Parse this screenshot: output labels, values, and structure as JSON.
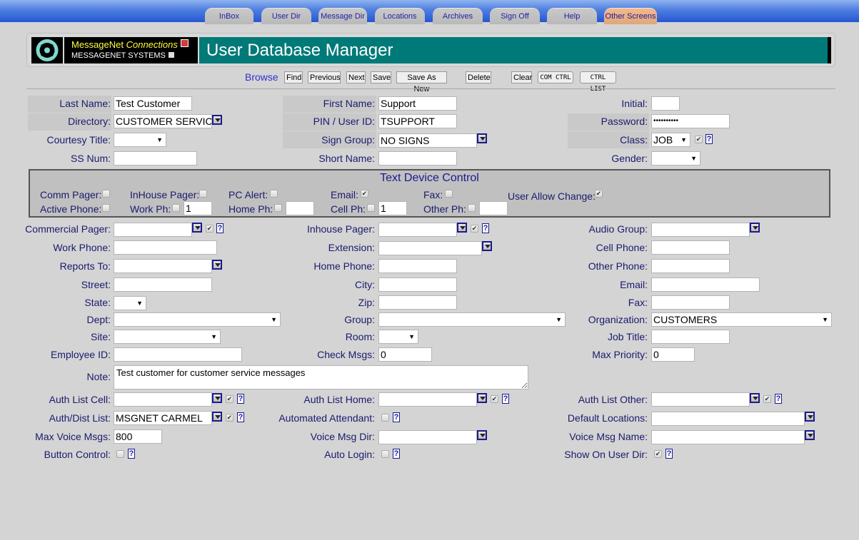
{
  "tabs": [
    {
      "label": "InBox",
      "active": false
    },
    {
      "label": "User Dir",
      "active": false
    },
    {
      "label": "Message Dir",
      "active": false
    },
    {
      "label": "Locations",
      "active": false
    },
    {
      "label": "Archives",
      "active": false
    },
    {
      "label": "Sign Off",
      "active": false
    },
    {
      "label": "Help",
      "active": false
    },
    {
      "label": "Other Screens",
      "active": true
    }
  ],
  "header": {
    "brand_line1_a": "MessageNet ",
    "brand_line1_b": "Connections",
    "brand_line2": "MESSAGENET SYSTEMS",
    "title": "User Database Manager",
    "accent_color": "#007a78"
  },
  "toolbar": {
    "mode": "Browse",
    "buttons": [
      "Find",
      "Previous",
      "Next",
      "Save",
      "Save As New",
      "Delete",
      "Clear",
      "COM CTRL",
      "CTRL LIST"
    ]
  },
  "fields": {
    "last_name": {
      "label": "Last Name:",
      "value": "Test Customer"
    },
    "first_name": {
      "label": "First Name:",
      "value": "Support"
    },
    "initial": {
      "label": "Initial:",
      "value": ""
    },
    "directory": {
      "label": "Directory:",
      "value": "CUSTOMER SERVICE"
    },
    "pin": {
      "label": "PIN / User ID:",
      "value": "TSUPPORT"
    },
    "password": {
      "label": "Password:",
      "value": "••••••••••"
    },
    "courtesy_title": {
      "label": "Courtesy Title:",
      "value": ""
    },
    "sign_group": {
      "label": "Sign Group:",
      "value": "NO SIGNS"
    },
    "class": {
      "label": "Class:",
      "value": "JOB",
      "checked": true
    },
    "ss_num": {
      "label": "SS Num:",
      "value": ""
    },
    "short_name": {
      "label": "Short Name:",
      "value": ""
    },
    "gender": {
      "label": "Gender:",
      "value": ""
    },
    "commercial_pager": {
      "label": "Commercial Pager:",
      "value": "",
      "checked": true
    },
    "inhouse_pager": {
      "label": "Inhouse Pager:",
      "value": "",
      "checked": true
    },
    "audio_group": {
      "label": "Audio Group:",
      "value": ""
    },
    "work_phone": {
      "label": "Work Phone:",
      "value": ""
    },
    "extension": {
      "label": "Extension:",
      "value": ""
    },
    "cell_phone": {
      "label": "Cell Phone:",
      "value": ""
    },
    "reports_to": {
      "label": "Reports To:",
      "value": ""
    },
    "home_phone": {
      "label": "Home Phone:",
      "value": ""
    },
    "other_phone": {
      "label": "Other Phone:",
      "value": ""
    },
    "street": {
      "label": "Street:",
      "value": ""
    },
    "city": {
      "label": "City:",
      "value": ""
    },
    "email": {
      "label": "Email:",
      "value": ""
    },
    "state": {
      "label": "State:",
      "value": ""
    },
    "zip": {
      "label": "Zip:",
      "value": ""
    },
    "fax": {
      "label": "Fax:",
      "value": ""
    },
    "dept": {
      "label": "Dept:",
      "value": ""
    },
    "group": {
      "label": "Group:",
      "value": ""
    },
    "organization": {
      "label": "Organization:",
      "value": "CUSTOMERS"
    },
    "site": {
      "label": "Site:",
      "value": ""
    },
    "room": {
      "label": "Room:",
      "value": ""
    },
    "job_title": {
      "label": "Job Title:",
      "value": ""
    },
    "employee_id": {
      "label": "Employee ID:",
      "value": ""
    },
    "check_msgs": {
      "label": "Check Msgs:",
      "value": "0"
    },
    "max_priority": {
      "label": "Max Priority:",
      "value": "0"
    },
    "note": {
      "label": "Note:",
      "value": "Test customer for customer service messages"
    },
    "auth_list_cell": {
      "label": "Auth List Cell:",
      "value": "",
      "checked": true
    },
    "auth_list_home": {
      "label": "Auth List Home:",
      "value": "",
      "checked": true
    },
    "auth_list_other": {
      "label": "Auth List Other:",
      "value": "",
      "checked": true
    },
    "auth_dist_list": {
      "label": "Auth/Dist List:",
      "value": "MSGNET CARMEL",
      "checked": true
    },
    "automated_attendant": {
      "label": "Automated Attendant:",
      "checked": false
    },
    "default_locations": {
      "label": "Default Locations:",
      "value": ""
    },
    "max_voice_msgs": {
      "label": "Max Voice Msgs:",
      "value": "800"
    },
    "voice_msg_dir": {
      "label": "Voice Msg Dir:",
      "value": ""
    },
    "voice_msg_name": {
      "label": "Voice Msg Name:",
      "value": ""
    },
    "button_control": {
      "label": "Button Control:",
      "checked": false
    },
    "auto_login": {
      "label": "Auto Login:",
      "checked": false
    },
    "show_on_user_dir": {
      "label": "Show On User Dir:",
      "checked": true
    }
  },
  "text_device_control": {
    "title": "Text Device Control",
    "comm_pager": {
      "label": "Comm Pager:",
      "checked": false
    },
    "inhouse_pager": {
      "label": "InHouse Pager:",
      "checked": false
    },
    "pc_alert": {
      "label": "PC Alert:",
      "checked": false
    },
    "email": {
      "label": "Email:",
      "checked": true
    },
    "fax": {
      "label": "Fax:",
      "checked": false
    },
    "user_allow_change": {
      "label": "User Allow Change:",
      "checked": true
    },
    "active_phone": {
      "label": "Active Phone:",
      "checked": false
    },
    "work_ph": {
      "label": "Work Ph:",
      "checked": false,
      "value": "1"
    },
    "home_ph": {
      "label": "Home Ph:",
      "checked": false,
      "value": ""
    },
    "cell_ph": {
      "label": "Cell Ph:",
      "checked": false,
      "value": "1"
    },
    "other_ph": {
      "label": "Other Ph:",
      "checked": false,
      "value": ""
    }
  },
  "help_glyph": "?",
  "check_glyph": "✔"
}
